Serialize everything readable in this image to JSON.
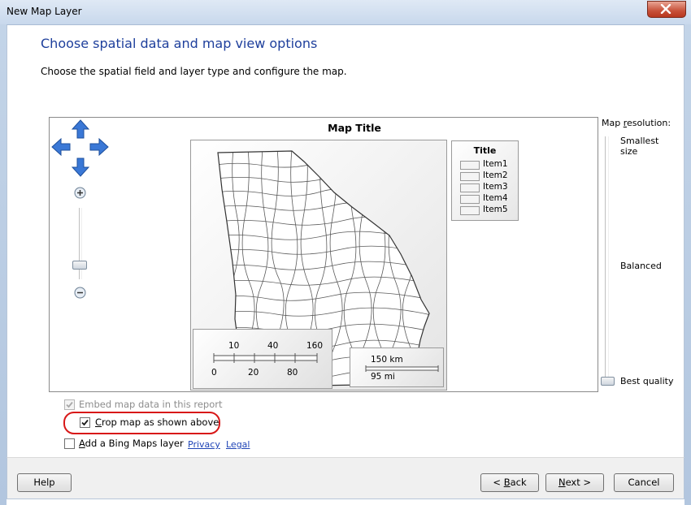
{
  "window": {
    "title": "New Map Layer"
  },
  "page": {
    "heading": "Choose spatial data and map view options",
    "subheading": "Choose the spatial field and layer type and configure the map."
  },
  "map": {
    "title": "Map Title",
    "legend": {
      "title": "Title",
      "items": [
        "Item1",
        "Item2",
        "Item3",
        "Item4",
        "Item5"
      ]
    },
    "distance_scale": {
      "top_ticks": [
        "10",
        "40",
        "160"
      ],
      "bottom_ticks": [
        "0",
        "20",
        "80"
      ]
    },
    "scale_bar": {
      "km": "150 km",
      "mi": "95 mi"
    }
  },
  "resolution": {
    "label_prefix": "Map ",
    "label_accel": "r",
    "label_suffix": "esolution:",
    "smallest_line1": "Smallest",
    "smallest_line2": "size",
    "balanced": "Balanced",
    "best": "Best quality",
    "level": 1.0
  },
  "zoom": {
    "level": 0.75
  },
  "options": {
    "embed": {
      "label": "Embed map data in this report",
      "checked": true,
      "disabled": true
    },
    "crop": {
      "label_accel": "C",
      "label_rest": "rop map as shown above",
      "checked": true
    },
    "bing": {
      "label_accel": "A",
      "label_rest": "dd a Bing Maps layer",
      "checked": false
    },
    "privacy_link": "Privacy",
    "legal_link": "Legal"
  },
  "footer": {
    "help": "Help",
    "back_prefix": "< ",
    "back_accel": "B",
    "back_rest": "ack",
    "next_accel": "N",
    "next_rest": "ext >",
    "cancel": "Cancel"
  },
  "colors": {
    "heading": "#1e3f9c",
    "arrow": "#3a78d6",
    "highlight": "#d81818",
    "link": "#1f44b6"
  }
}
